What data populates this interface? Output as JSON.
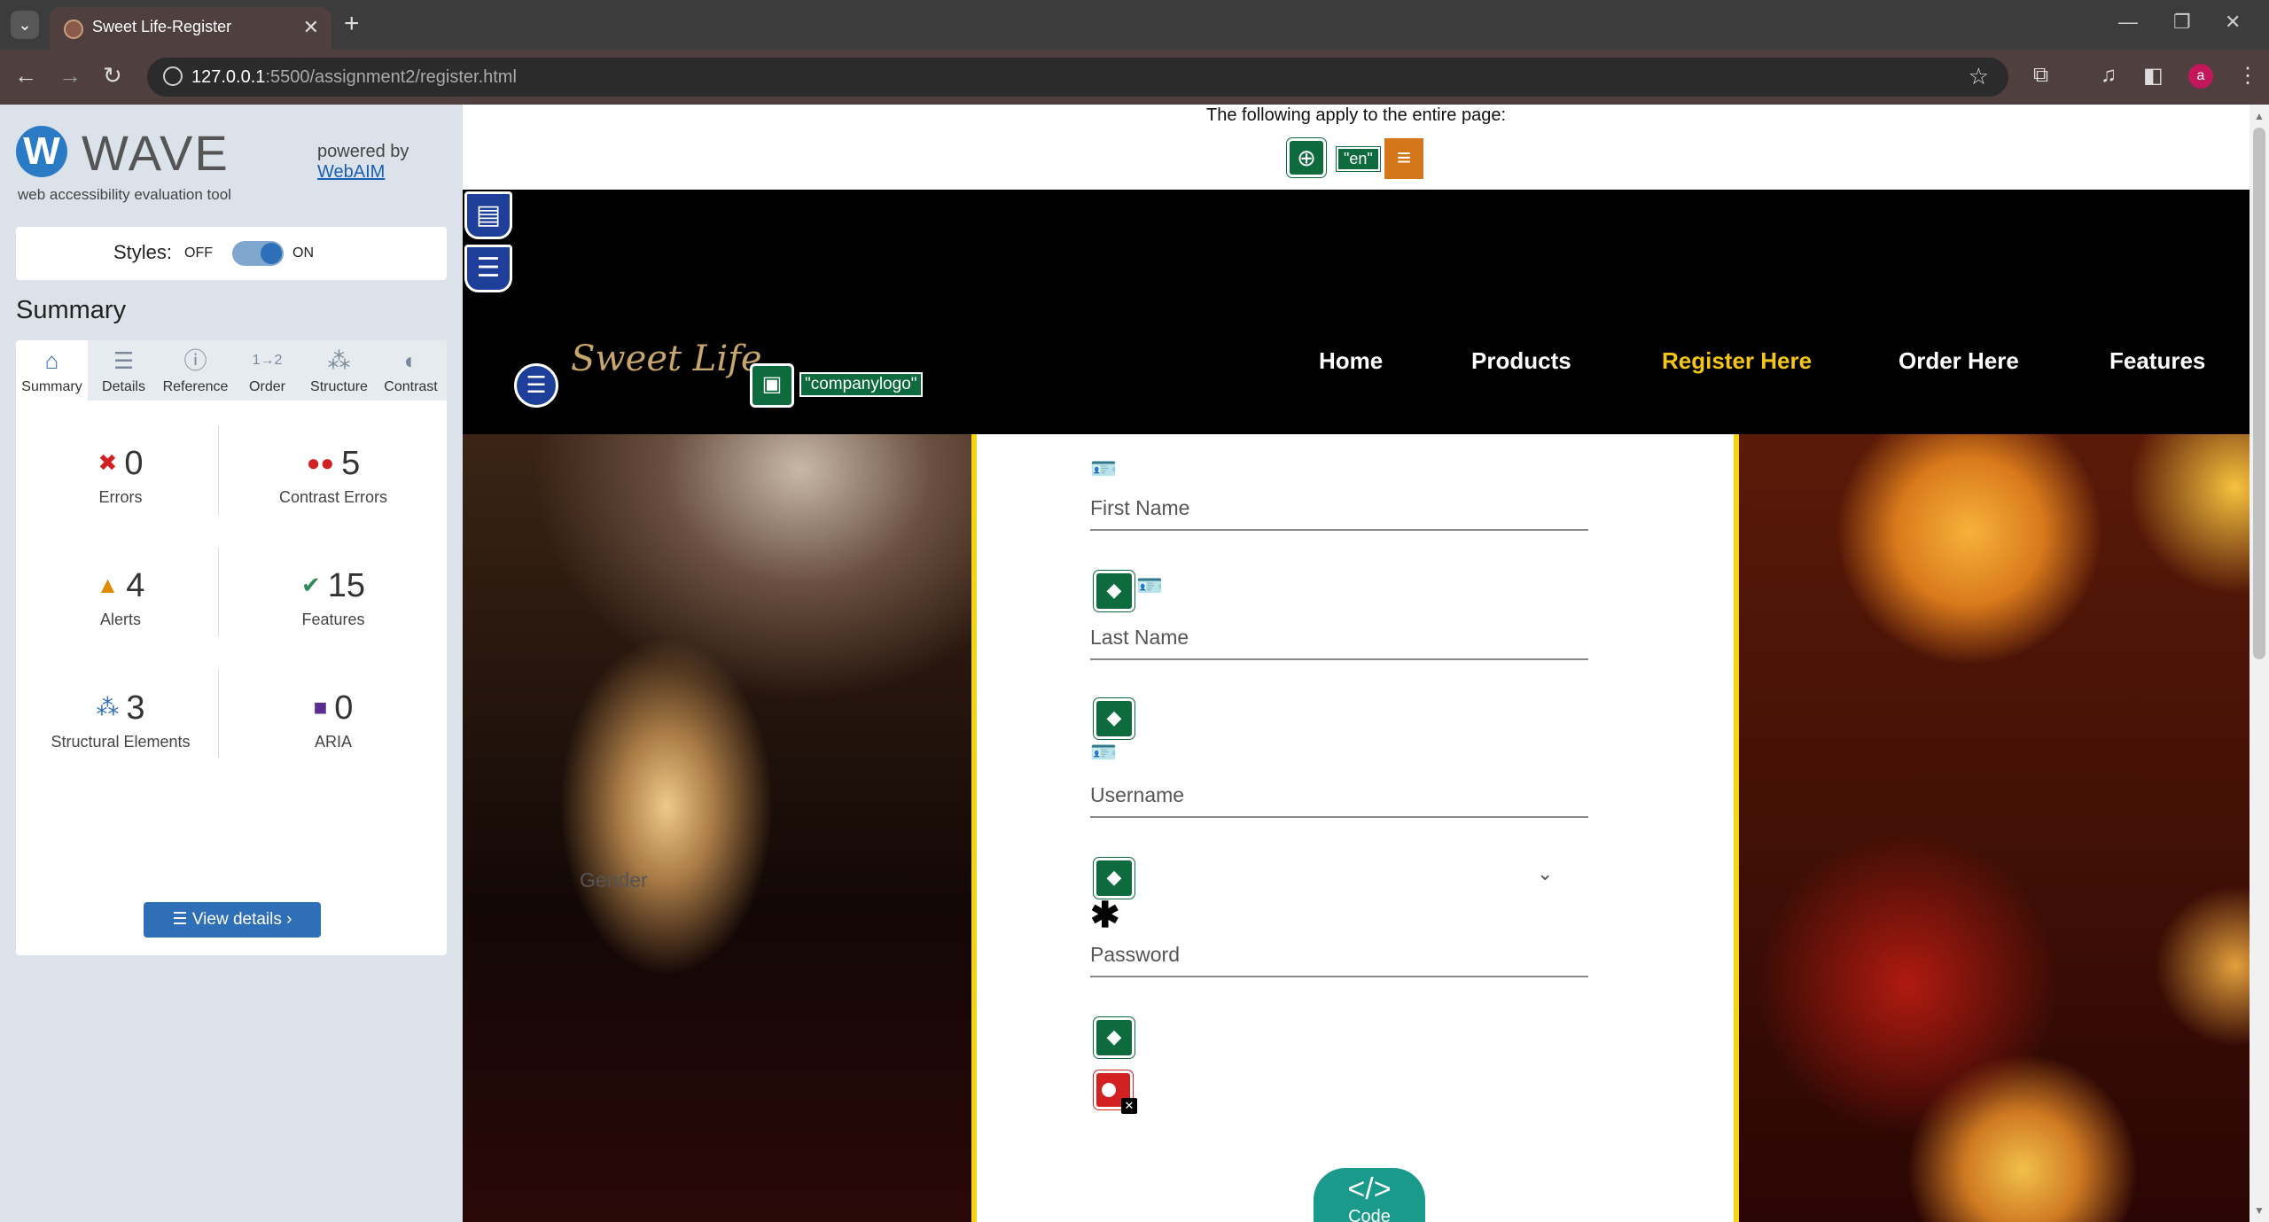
{
  "browser": {
    "tab_title": "Sweet Life-Register",
    "url_host": "127.0.0.1",
    "url_path": ":5500/assignment2/register.html"
  },
  "wave": {
    "name": "WAVE",
    "tagline": "web accessibility evaluation tool",
    "powered_by": "powered by",
    "webaim_link": "WebAIM",
    "styles_label": "Styles:",
    "styles_off": "OFF",
    "styles_on": "ON",
    "summary_heading": "Summary",
    "tabs": [
      {
        "label": "Summary",
        "icon": "home-icon"
      },
      {
        "label": "Details",
        "icon": "list-icon"
      },
      {
        "label": "Reference",
        "icon": "info-icon"
      },
      {
        "label": "Order",
        "icon": "order-icon"
      },
      {
        "label": "Structure",
        "icon": "structure-icon"
      },
      {
        "label": "Contrast",
        "icon": "contrast-icon"
      }
    ],
    "stats": {
      "errors": {
        "value": "0",
        "label": "Errors"
      },
      "contrast": {
        "value": "5",
        "label": "Contrast Errors"
      },
      "alerts": {
        "value": "4",
        "label": "Alerts"
      },
      "features": {
        "value": "15",
        "label": "Features"
      },
      "structural": {
        "value": "3",
        "label": "Structural Elements"
      },
      "aria": {
        "value": "0",
        "label": "ARIA"
      }
    },
    "view_details": "View details ›"
  },
  "page": {
    "apply_text": "The following apply to the entire page:",
    "lang_tag": "\"en\"",
    "brand": "Sweet Life",
    "logo_alt": "\"companylogo\"",
    "nav": [
      "Home",
      "Products",
      "Register Here",
      "Order Here",
      "Features"
    ],
    "active_nav": "Register Here",
    "fields": {
      "first_name": "First Name",
      "last_name": "Last Name",
      "username": "Username",
      "password": "Password",
      "gender": "Gender"
    },
    "code_button": "Code",
    "code_glyph": "</>"
  },
  "colors": {
    "wave_blue": "#2f6fb8",
    "wave_green": "#0e6b3d",
    "active_nav": "#f5c518",
    "stripe": "#f5d416"
  }
}
